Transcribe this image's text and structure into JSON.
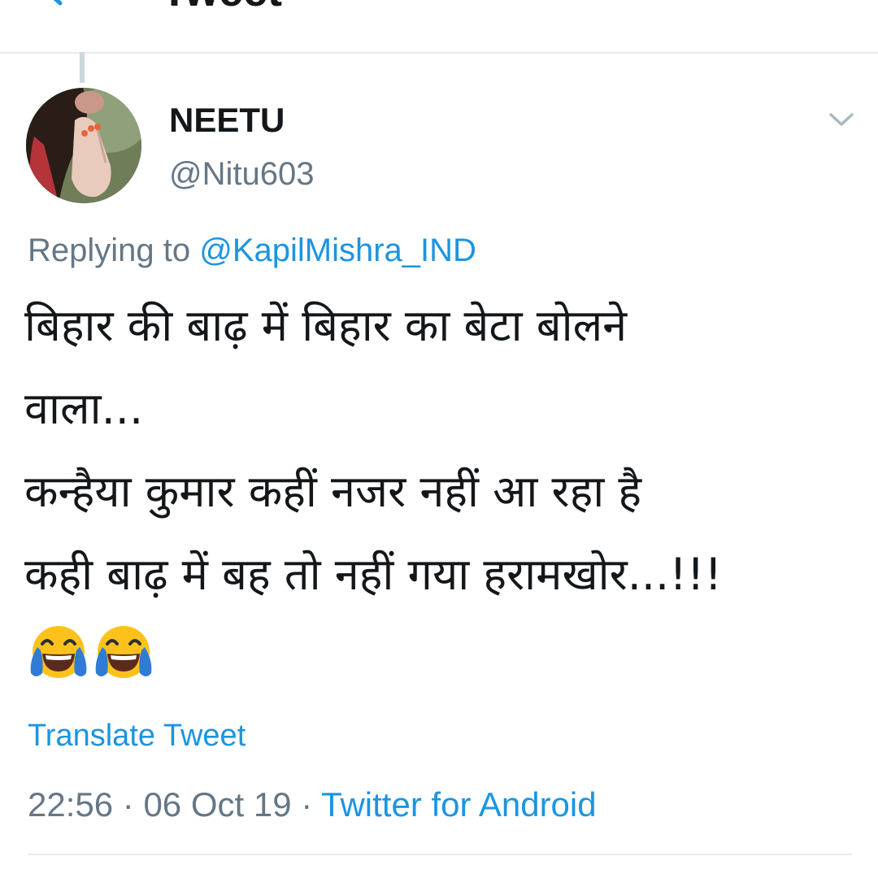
{
  "header": {
    "title": "Tweet",
    "back_icon": "arrow-left-icon"
  },
  "tweet": {
    "author": {
      "display_name": "NEETU",
      "handle": "@Nitu603"
    },
    "replying_prefix": "Replying to ",
    "replying_to": "@KapilMishra_IND",
    "text_lines": [
      "बिहार की बाढ़ में बिहार का बेटा बोलने",
      "वाला...",
      "कन्हैया कुमार कहीं नजर नहीं आ रहा है",
      "कही बाढ़ में बह तो नहीं गया हरामखोर...!!!"
    ],
    "emojis": [
      "face-with-tears-of-joy-emoji",
      "face-with-tears-of-joy-emoji"
    ],
    "translate_label": "Translate Tweet",
    "time": "22:56",
    "separator": " · ",
    "date": "06 Oct 19",
    "source": "Twitter for Android",
    "more_icon": "chevron-down-icon"
  },
  "colors": {
    "accent": "#1b95e0",
    "text_primary": "#14171a",
    "text_secondary": "#657786",
    "divider": "#e6ecf0"
  }
}
